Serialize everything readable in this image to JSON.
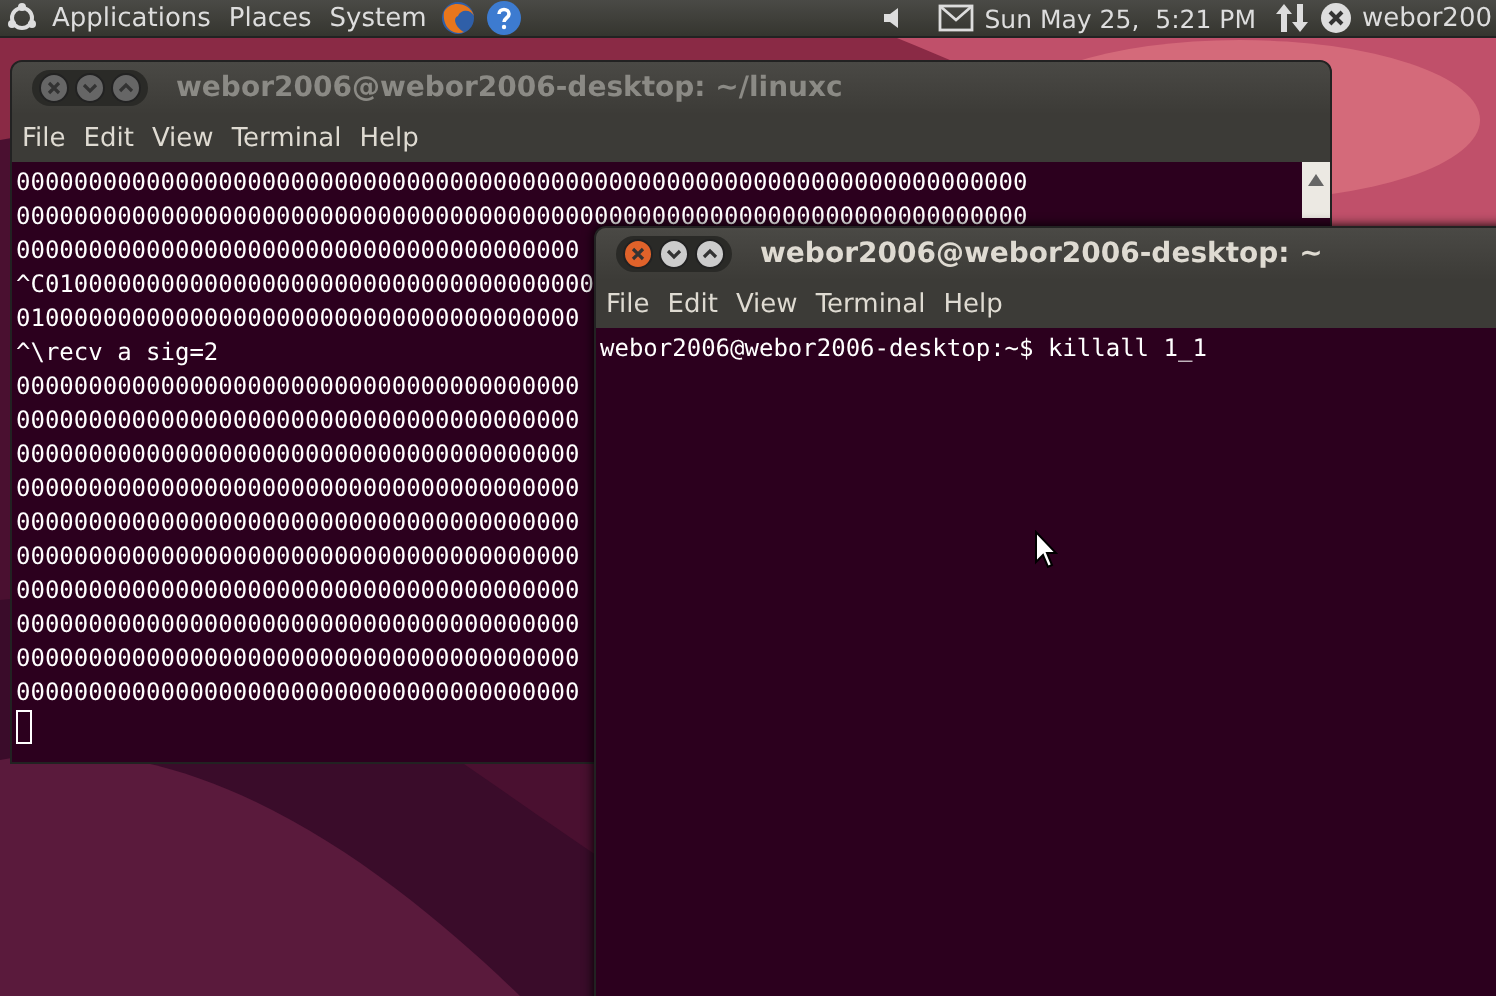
{
  "panel": {
    "menus": [
      "Applications",
      "Places",
      "System"
    ],
    "clock": "Sun May 25,  5:21 PM",
    "user": "webor200"
  },
  "windows": [
    {
      "title": "webor2006@webor2006-desktop: ~/linuxc",
      "focused": false,
      "menu": [
        "File",
        "Edit",
        "View",
        "Terminal",
        "Help"
      ],
      "scrollbar": true,
      "cursor": true,
      "lines": [
        "0000000000000000000000000000000000000000000000000000000000000000000000",
        "0000000000000000000000000000000000000000000000000000000000000000000000",
        "000000000000000000000000000000000000000",
        "^C01000000000000000000000000000000000000",
        "010000000000000000000000000000000000000",
        "^\\recv a sig=2",
        "000000000000000000000000000000000000000",
        "000000000000000000000000000000000000000",
        "000000000000000000000000000000000000000",
        "000000000000000000000000000000000000000",
        "000000000000000000000000000000000000000",
        "000000000000000000000000000000000000000",
        "000000000000000000000000000000000000000",
        "000000000000000000000000000000000000000",
        "000000000000000000000000000000000000000",
        "000000000000000000000000000000000000000"
      ]
    },
    {
      "title": "webor2006@webor2006-desktop: ~",
      "focused": true,
      "menu": [
        "File",
        "Edit",
        "View",
        "Terminal",
        "Help"
      ],
      "lines": [
        "webor2006@webor2006-desktop:~$ killall 1_1"
      ]
    }
  ]
}
